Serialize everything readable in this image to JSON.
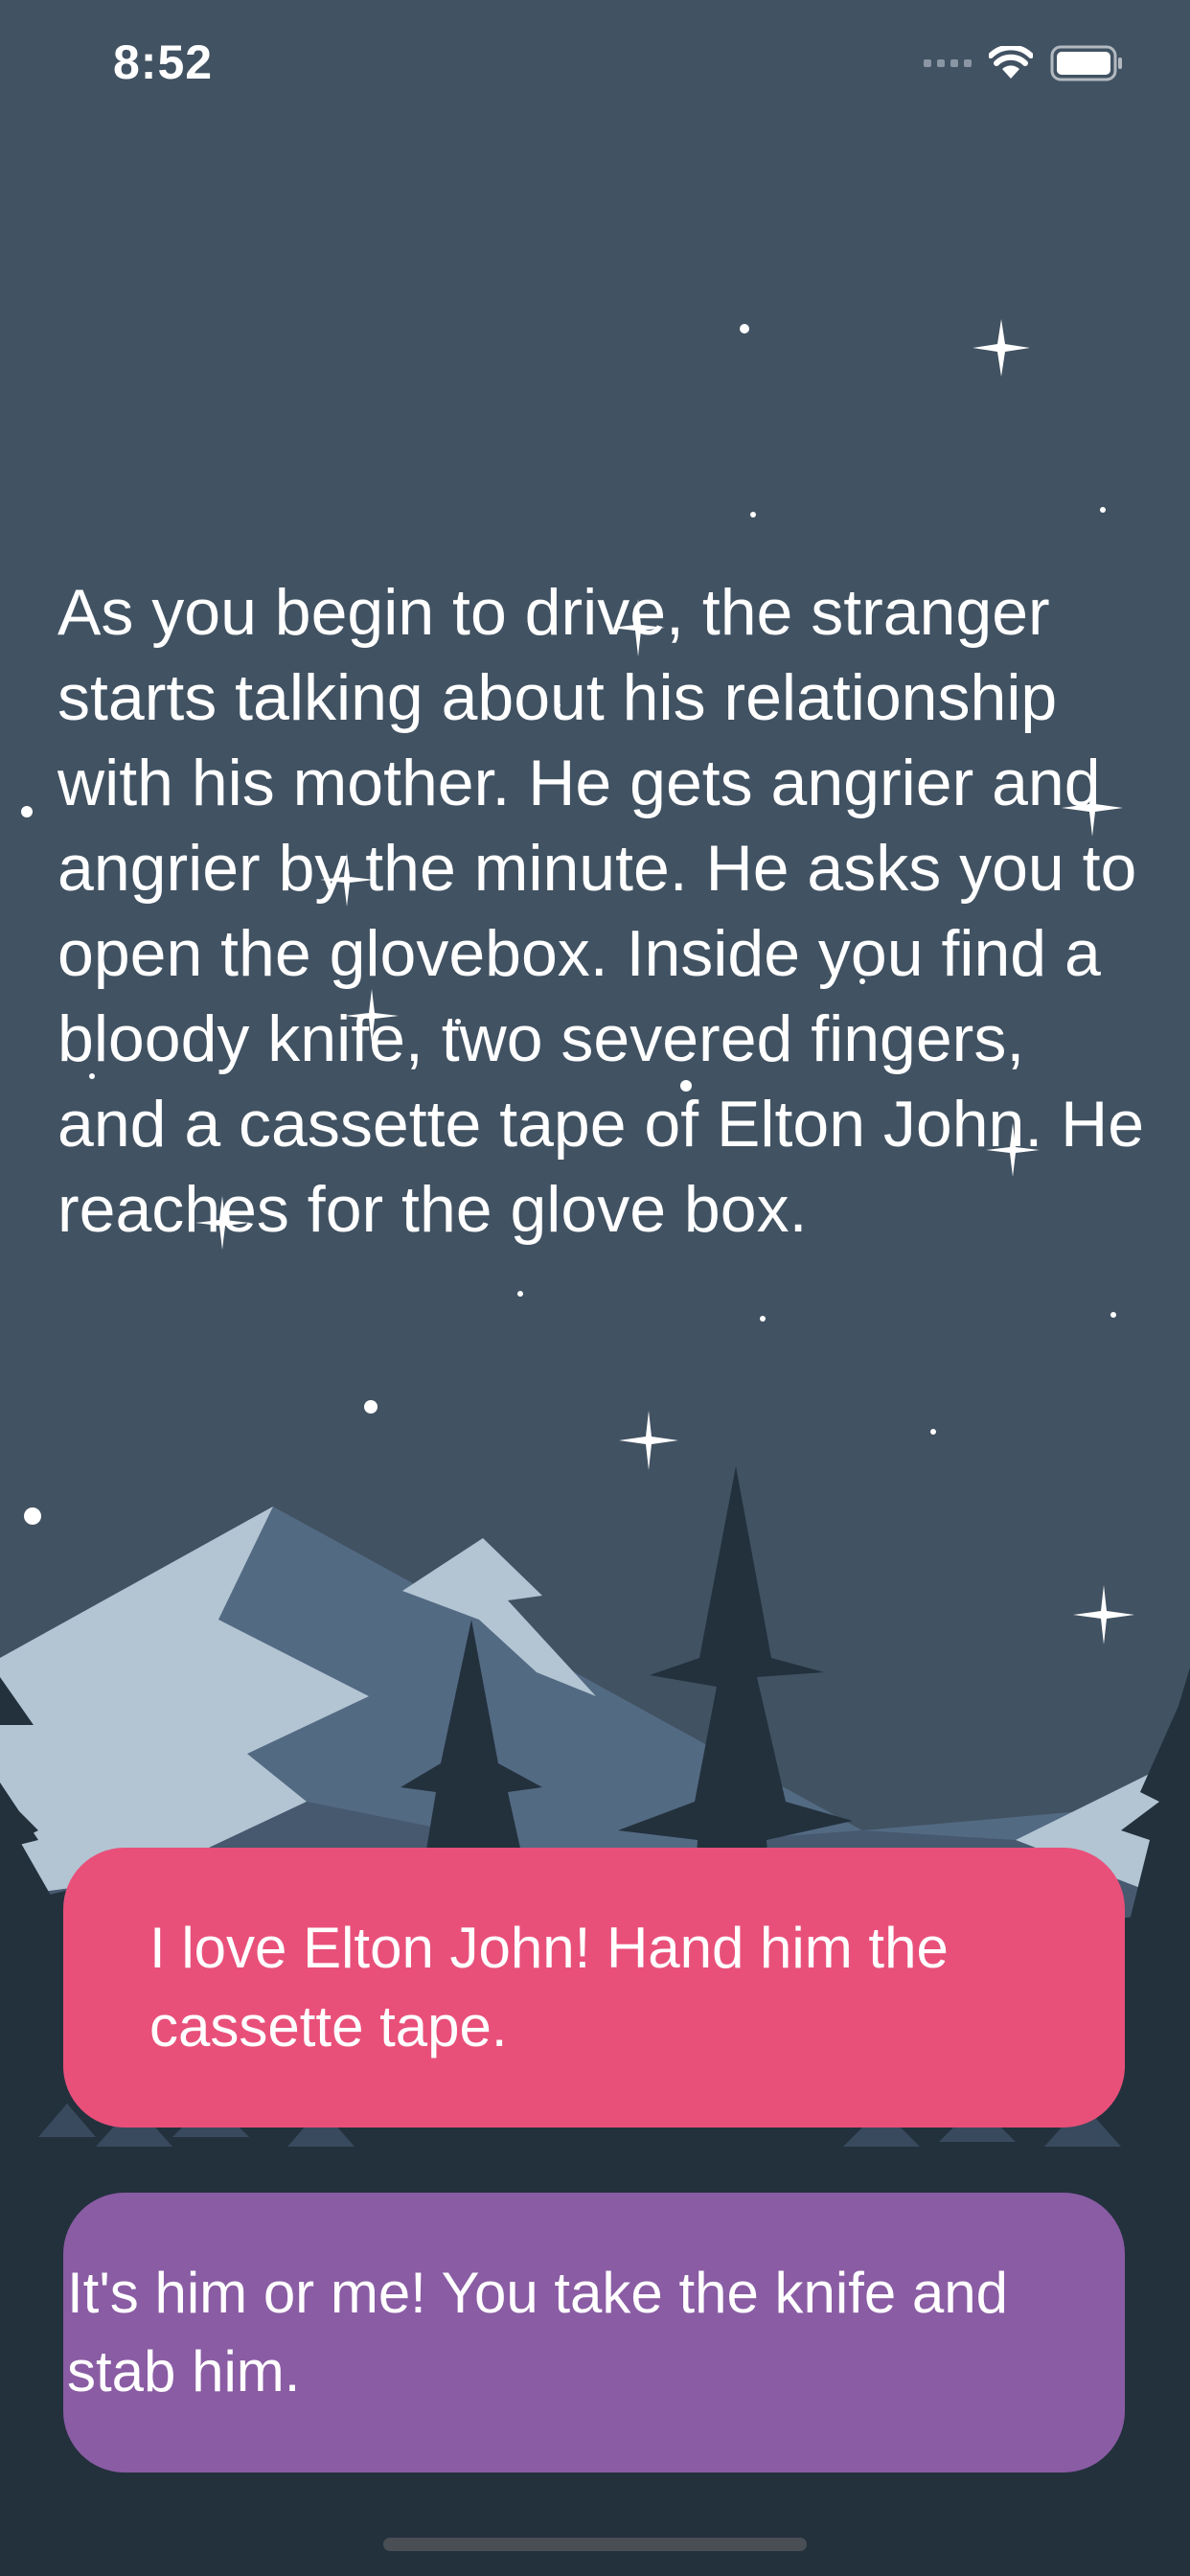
{
  "status_bar": {
    "time": "8:52"
  },
  "story": {
    "text": "As you begin to drive, the stranger starts talking about his relationship with his mother. He gets angrier and angrier by the minute. He asks you to open the glovebox. Inside you find a bloody knife, two severed fingers, and a cassette tape of Elton John. He reaches for the glove box."
  },
  "choices": [
    {
      "label": "I love Elton John! Hand him the cassette tape.",
      "color": "#e8507a"
    },
    {
      "label": "It's him or me! You take the knife and stab him.",
      "color": "#8a5ca4"
    }
  ],
  "colors": {
    "sky": "#415262",
    "mountain_light": "#b3c5d3",
    "mountain_mid": "#536a83",
    "tree_dark": "#23313d",
    "tree_far": "#4b607a"
  }
}
